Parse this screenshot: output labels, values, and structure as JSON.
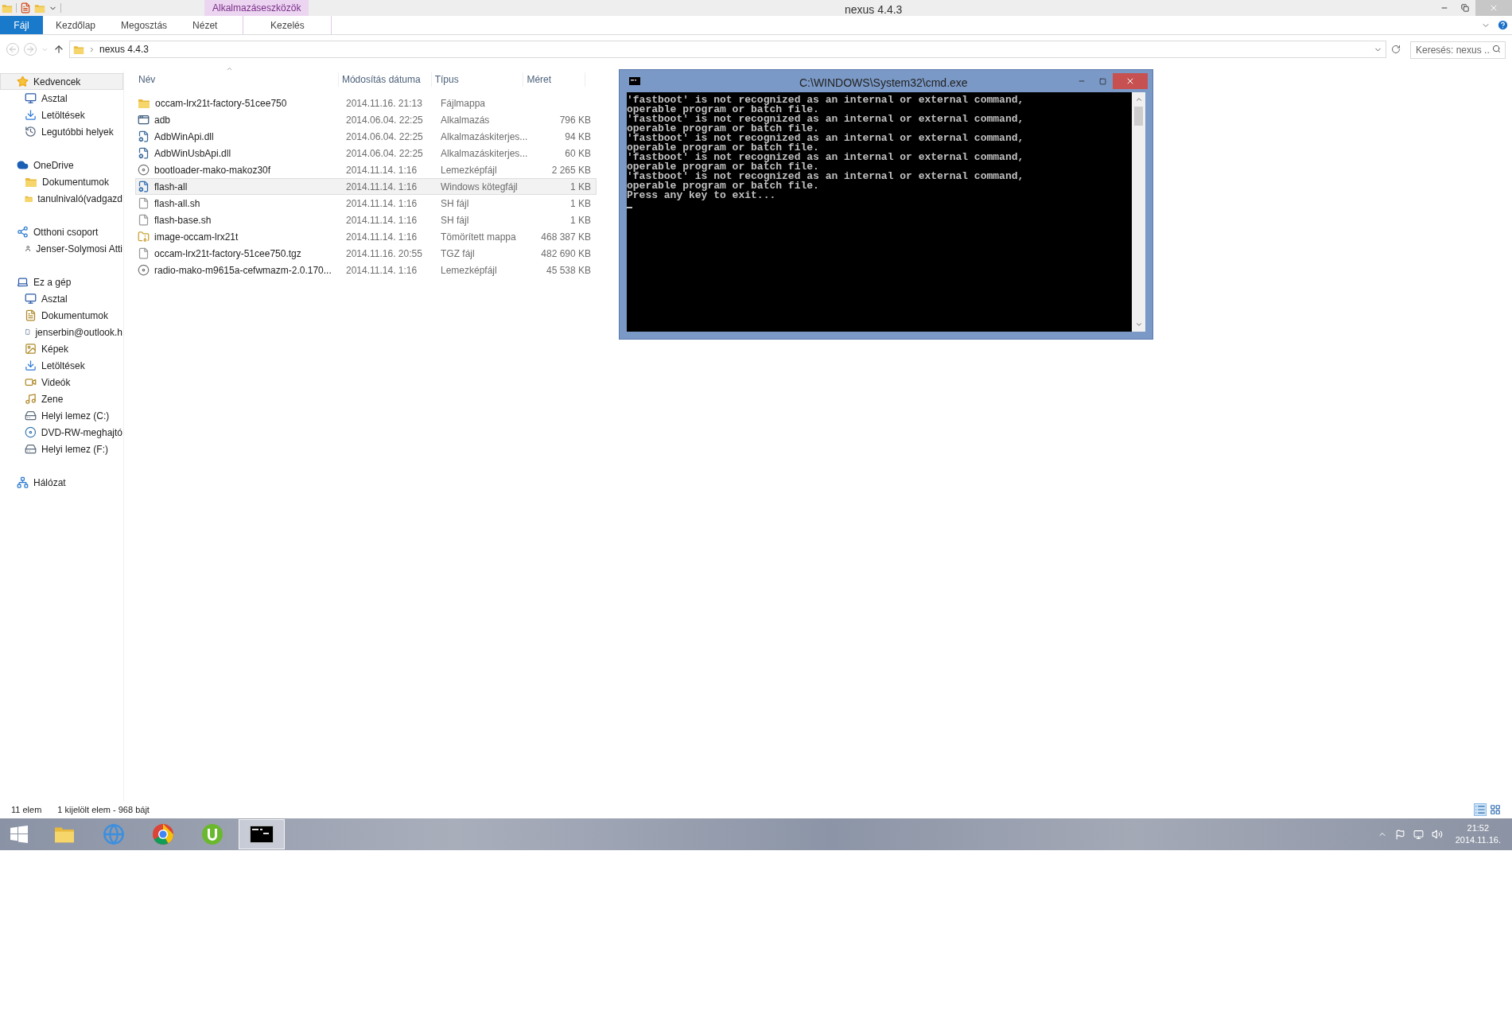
{
  "window": {
    "title": "nexus 4.4.3"
  },
  "ribbon": {
    "context_group": "Alkalmazáseszközök",
    "tabs": [
      {
        "label": "Fájl",
        "kind": "file"
      },
      {
        "label": "Kezdőlap",
        "kind": "normal"
      },
      {
        "label": "Megosztás",
        "kind": "normal"
      },
      {
        "label": "Nézet",
        "kind": "normal"
      },
      {
        "label": "Kezelés",
        "kind": "contextual"
      }
    ]
  },
  "address_bar": {
    "path": [
      "nexus 4.4.3"
    ]
  },
  "search": {
    "placeholder": "Keresés: nexus ..."
  },
  "navigation": [
    {
      "label": "Kedvencek",
      "kind": "star",
      "selected": true,
      "children": [
        {
          "label": "Asztal",
          "kind": "desktop",
          "selected": false
        },
        {
          "label": "Letöltések",
          "kind": "downloads",
          "selected": false
        },
        {
          "label": "Legutóbbi helyek",
          "kind": "recent",
          "selected": false
        }
      ]
    },
    {
      "label": "OneDrive",
      "kind": "cloud",
      "selected": false,
      "children": [
        {
          "label": "Dokumentumok",
          "kind": "folder",
          "selected": false
        },
        {
          "label": "tanulnivaló(vadgazd",
          "kind": "folder",
          "selected": false
        }
      ]
    },
    {
      "label": "Otthoni csoport",
      "kind": "homegroup",
      "selected": false,
      "children": [
        {
          "label": "Jenser-Solymosi Atti",
          "kind": "user",
          "selected": false
        }
      ]
    },
    {
      "label": "Ez a gép",
      "kind": "computer",
      "selected": false,
      "children": [
        {
          "label": "Asztal",
          "kind": "desktop",
          "selected": false
        },
        {
          "label": "Dokumentumok",
          "kind": "documents",
          "selected": false
        },
        {
          "label": "jenserbin@outlook.h",
          "kind": "phone",
          "selected": false
        },
        {
          "label": "Képek",
          "kind": "pictures",
          "selected": false
        },
        {
          "label": "Letöltések",
          "kind": "downloads",
          "selected": false
        },
        {
          "label": "Videók",
          "kind": "videos",
          "selected": false
        },
        {
          "label": "Zene",
          "kind": "music",
          "selected": false
        },
        {
          "label": "Helyi lemez (C:)",
          "kind": "drive",
          "selected": false
        },
        {
          "label": "DVD-RW-meghajtó",
          "kind": "dvd",
          "selected": false
        },
        {
          "label": "Helyi lemez (F:)",
          "kind": "drive",
          "selected": false
        }
      ]
    },
    {
      "label": "Hálózat",
      "kind": "network",
      "selected": false
    }
  ],
  "file_list": {
    "columns": [
      "Név",
      "Módosítás dátuma",
      "Típus",
      "Méret"
    ],
    "rows": [
      {
        "name": "occam-lrx21t-factory-51cee750",
        "date": "2014.11.16. 21:13",
        "type": "Fájlmappa",
        "size": "",
        "kind": "folder",
        "selected": false
      },
      {
        "name": "adb",
        "date": "2014.06.04. 22:25",
        "type": "Alkalmazás",
        "size": "796 KB",
        "kind": "app",
        "selected": false
      },
      {
        "name": "AdbWinApi.dll",
        "date": "2014.06.04. 22:25",
        "type": "Alkalmazáskiterjes...",
        "size": "94 KB",
        "kind": "dll",
        "selected": false
      },
      {
        "name": "AdbWinUsbApi.dll",
        "date": "2014.06.04. 22:25",
        "type": "Alkalmazáskiterjes...",
        "size": "60 KB",
        "kind": "dll",
        "selected": false
      },
      {
        "name": "bootloader-mako-makoz30f",
        "date": "2014.11.14. 1:16",
        "type": "Lemezképfájl",
        "size": "2 265 KB",
        "kind": "image",
        "selected": false
      },
      {
        "name": "flash-all",
        "date": "2014.11.14. 1:16",
        "type": "Windows kötegfájl",
        "size": "1 KB",
        "kind": "batch",
        "selected": true
      },
      {
        "name": "flash-all.sh",
        "date": "2014.11.14. 1:16",
        "type": "SH fájl",
        "size": "1 KB",
        "kind": "file",
        "selected": false
      },
      {
        "name": "flash-base.sh",
        "date": "2014.11.14. 1:16",
        "type": "SH fájl",
        "size": "1 KB",
        "kind": "file",
        "selected": false
      },
      {
        "name": "image-occam-lrx21t",
        "date": "2014.11.14. 1:16",
        "type": "Tömörített mappa",
        "size": "468 387 KB",
        "kind": "zip",
        "selected": false
      },
      {
        "name": "occam-lrx21t-factory-51cee750.tgz",
        "date": "2014.11.16. 20:55",
        "type": "TGZ fájl",
        "size": "482 690 KB",
        "kind": "file",
        "selected": false
      },
      {
        "name": "radio-mako-m9615a-cefwmazm-2.0.170...",
        "date": "2014.11.14. 1:16",
        "type": "Lemezképfájl",
        "size": "45 538 KB",
        "kind": "image",
        "selected": false
      }
    ]
  },
  "status_bar": {
    "item_count": "11 elem",
    "selection": "1 kijelölt elem - 968 bájt"
  },
  "console": {
    "title": "C:\\WINDOWS\\System32\\cmd.exe",
    "lines": [
      "'fastboot' is not recognized as an internal or external command,",
      "operable program or batch file.",
      "'fastboot' is not recognized as an internal or external command,",
      "operable program or batch file.",
      "'fastboot' is not recognized as an internal or external command,",
      "operable program or batch file.",
      "'fastboot' is not recognized as an internal or external command,",
      "operable program or batch file.",
      "'fastboot' is not recognized as an internal or external command,",
      "operable program or batch file.",
      "Press any key to exit..."
    ]
  },
  "taskbar": {
    "apps": [
      {
        "kind": "explorer",
        "selected": false
      },
      {
        "kind": "ie",
        "selected": false
      },
      {
        "kind": "chrome",
        "selected": false
      },
      {
        "kind": "torrent",
        "selected": false
      },
      {
        "kind": "console",
        "selected": true
      }
    ],
    "clock": {
      "time": "21:52",
      "date": "2014.11.16."
    }
  }
}
